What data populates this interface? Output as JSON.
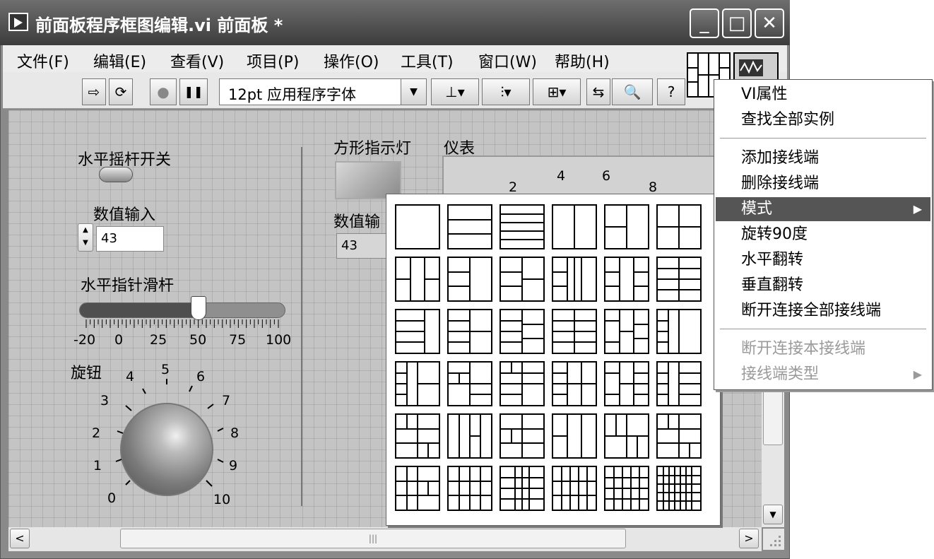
{
  "window": {
    "title": "前面板程序框图编辑.vi 前面板 *",
    "buttons": {
      "minimize": "_",
      "maximize": "□",
      "close": "✕"
    }
  },
  "menubar": [
    "文件(F)",
    "编辑(E)",
    "查看(V)",
    "项目(P)",
    "操作(O)",
    "工具(T)",
    "窗口(W)",
    "帮助(H)"
  ],
  "toolbar": {
    "run": "⇨",
    "run_continuously": "⟳",
    "abort": "●",
    "pause": "❚❚",
    "font": "12pt 应用程序字体",
    "font_arrow": "▼",
    "align": "⊥▾",
    "distribute": "⫶▾",
    "resize": "⊞▾",
    "reorder": "⇆",
    "search": "🔍",
    "help": "?"
  },
  "panel": {
    "toggle_label": "水平摇杆开关",
    "numeric_label": "数值输入",
    "numeric_value": "43",
    "slider_label": "水平指针滑杆",
    "slider_ticks": [
      "-20",
      "0",
      "25",
      "50",
      "75",
      "100"
    ],
    "slider_value_fraction": 0.58,
    "knob_label": "旋钮",
    "knob_ticks": [
      "0",
      "1",
      "2",
      "3",
      "4",
      "5",
      "6",
      "7",
      "8",
      "9",
      "10"
    ],
    "led_label": "方形指示灯",
    "numeric2_label": "数值输",
    "numeric2_value": "43",
    "gauge_label": "仪表",
    "gauge_ticks": [
      "2",
      "4",
      "6",
      "8"
    ]
  },
  "context_menu": {
    "items": [
      {
        "label": "VI属性",
        "state": "normal"
      },
      {
        "label": "查找全部实例",
        "state": "normal"
      },
      {
        "label": "添加接线端",
        "state": "normal"
      },
      {
        "label": "删除接线端",
        "state": "normal"
      },
      {
        "label": "模式",
        "state": "highlighted",
        "submenu": true
      },
      {
        "label": "旋转90度",
        "state": "normal"
      },
      {
        "label": "水平翻转",
        "state": "normal"
      },
      {
        "label": "垂直翻转",
        "state": "normal"
      },
      {
        "label": "断开连接全部接线端",
        "state": "normal"
      },
      {
        "label": "断开连接本接线端",
        "state": "disabled"
      },
      {
        "label": "接线端类型",
        "state": "disabled",
        "submenu": true
      }
    ],
    "submenu_arrow": "▶"
  },
  "scroll": {
    "up": "▲",
    "down": "▼",
    "left": "<",
    "right": ">",
    "grip": "|||"
  }
}
